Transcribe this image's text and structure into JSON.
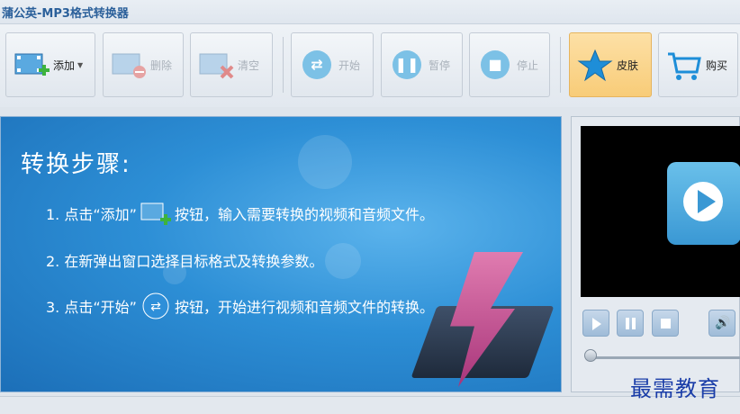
{
  "window": {
    "title": "蒲公英-MP3格式转换器"
  },
  "toolbar": {
    "add_label": "添加",
    "delete_label": "删除",
    "clear_label": "清空",
    "start_label": "开始",
    "pause_label": "暂停",
    "stop_label": "停止",
    "skin_label": "皮肤",
    "buy_label": "购买"
  },
  "banner": {
    "heading": "转换步骤:",
    "step1_pre": "1. 点击“添加”",
    "step1_post": "按钮，输入需要转换的视频和音频文件。",
    "step2": "2. 在新弹出窗口选择目标格式及转换参数。",
    "step3_pre": "3. 点击“开始”",
    "step3_post": "按钮，开始进行视频和音频文件的转换。"
  },
  "watermark": "最需教育",
  "colors": {
    "accent": "#2d8fd6",
    "skin_button": "#f8cc78"
  },
  "icons": [
    "film-add-icon",
    "film-delete-icon",
    "film-clear-icon",
    "shuffle-icon",
    "pause-icon",
    "stop-icon",
    "star-icon",
    "cart-icon",
    "play-icon",
    "volume-icon"
  ]
}
